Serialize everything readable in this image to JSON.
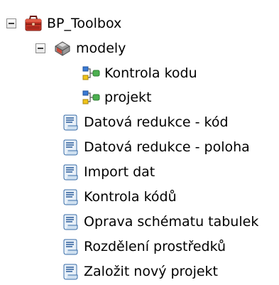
{
  "tree": {
    "root": {
      "label": "BP_Toolbox",
      "icon": "toolbox-icon",
      "expanded": true
    },
    "toolset": {
      "label": "modely",
      "icon": "toolset-icon",
      "expanded": true
    },
    "models": [
      {
        "label": "Kontrola kodu",
        "icon": "model-icon"
      },
      {
        "label": "projekt",
        "icon": "model-icon"
      }
    ],
    "scripts": [
      {
        "label": "Datová redukce - kód",
        "icon": "script-icon"
      },
      {
        "label": "Datová redukce - poloha",
        "icon": "script-icon"
      },
      {
        "label": "Import dat",
        "icon": "script-icon"
      },
      {
        "label": "Kontrola kódů",
        "icon": "script-icon"
      },
      {
        "label": "Oprava schématu tabulek",
        "icon": "script-icon"
      },
      {
        "label": "Rozdělení prostředků",
        "icon": "script-icon"
      },
      {
        "label": "Založit nový projekt",
        "icon": "script-icon"
      }
    ]
  }
}
